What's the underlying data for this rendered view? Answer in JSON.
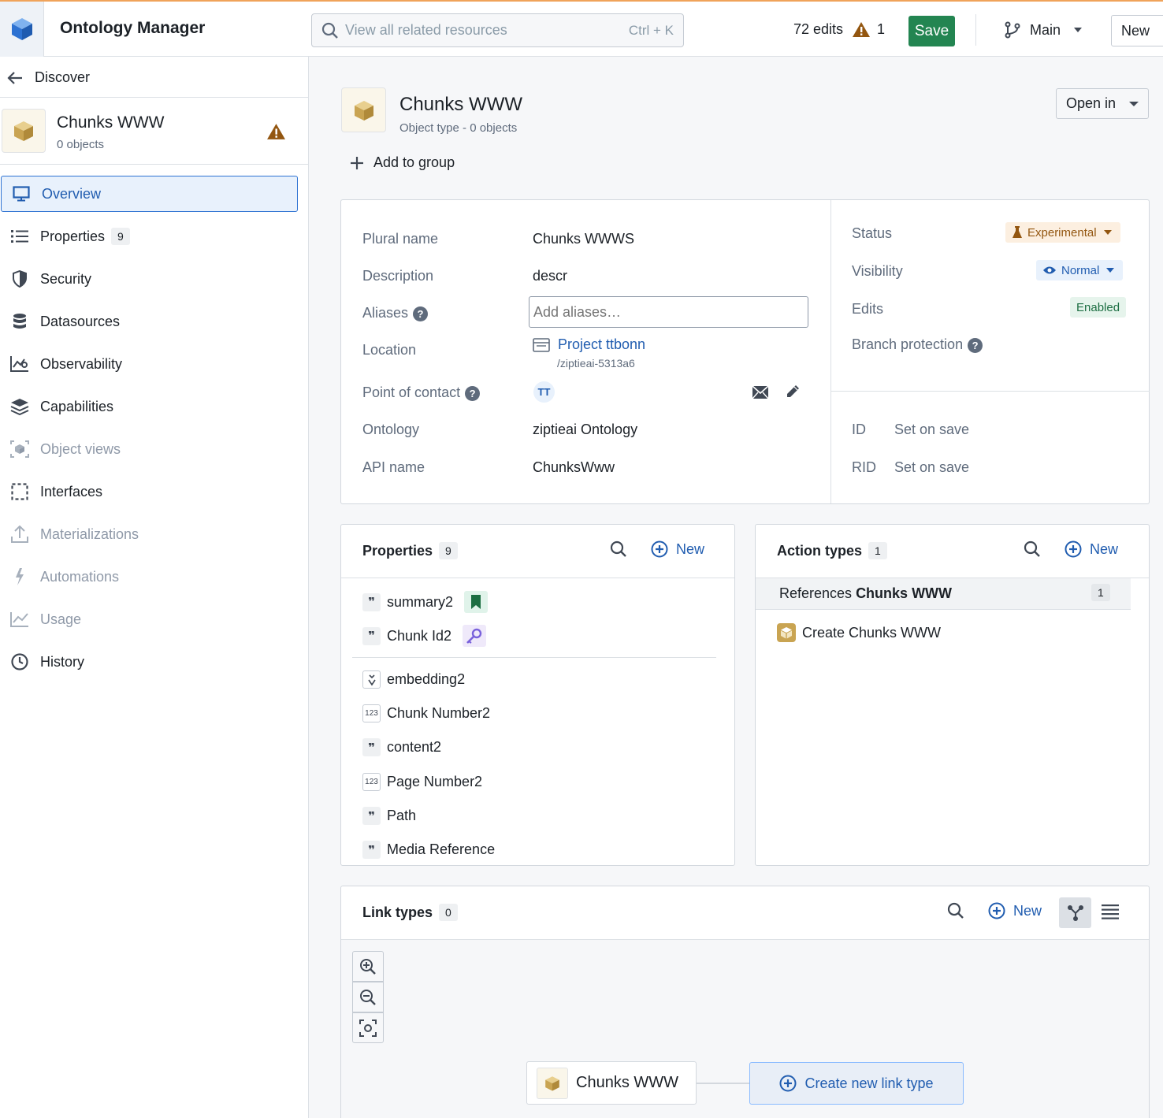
{
  "app": {
    "title": "Ontology Manager"
  },
  "search": {
    "placeholder": "View all related resources",
    "shortcut": "Ctrl + K"
  },
  "topbar": {
    "edits": "72 edits",
    "warnings": "1",
    "save_label": "Save",
    "branch": "Main",
    "new_label": "New"
  },
  "sidebar": {
    "back_label": "Discover",
    "object": {
      "name": "Chunks WWW",
      "count": "0 objects"
    },
    "items": [
      {
        "label": "Overview",
        "icon": "desktop-icon",
        "state": "active"
      },
      {
        "label": "Properties",
        "icon": "list-icon",
        "badge": "9"
      },
      {
        "label": "Security",
        "icon": "shield-icon"
      },
      {
        "label": "Datasources",
        "icon": "database-icon"
      },
      {
        "label": "Observability",
        "icon": "chart-icon"
      },
      {
        "label": "Capabilities",
        "icon": "layers-icon"
      },
      {
        "label": "Object views",
        "icon": "object-view-icon",
        "state": "disabled"
      },
      {
        "label": "Interfaces",
        "icon": "dashed-square-icon"
      },
      {
        "label": "Materializations",
        "icon": "upload-icon",
        "state": "disabled"
      },
      {
        "label": "Automations",
        "icon": "lightning-icon",
        "state": "disabled"
      },
      {
        "label": "Usage",
        "icon": "timeline-icon",
        "state": "disabled"
      },
      {
        "label": "History",
        "icon": "clock-icon"
      }
    ]
  },
  "header": {
    "title": "Chunks WWW",
    "subtitle": "Object type - 0 objects",
    "open_in": "Open in",
    "add_group": "Add to group"
  },
  "details": {
    "plural_label": "Plural name",
    "plural_value": "Chunks WWWS",
    "desc_label": "Description",
    "desc_value": "descr",
    "aliases_label": "Aliases",
    "aliases_placeholder": "Add aliases…",
    "location_label": "Location",
    "location_value": "Project ttbonn",
    "location_path": "/ziptieai-5313a6",
    "contact_label": "Point of contact",
    "contact_initials": "TT",
    "ontology_label": "Ontology",
    "ontology_value": "ziptieai Ontology",
    "api_label": "API name",
    "api_value": "ChunksWww"
  },
  "meta": {
    "status_label": "Status",
    "status_value": "Experimental",
    "visibility_label": "Visibility",
    "visibility_value": "Normal",
    "edits_label": "Edits",
    "edits_value": "Enabled",
    "branch_label": "Branch protection",
    "id_label": "ID",
    "id_value": "Set on save",
    "rid_label": "RID",
    "rid_value": "Set on save"
  },
  "properties_panel": {
    "title": "Properties",
    "count": "9",
    "new_label": "New",
    "items": [
      {
        "name": "summary2",
        "type": "string"
      },
      {
        "name": "Chunk Id2",
        "type": "string"
      },
      {
        "name": "embedding2",
        "type": "vector"
      },
      {
        "name": "Chunk Number2",
        "type": "integer"
      },
      {
        "name": "content2",
        "type": "string"
      },
      {
        "name": "Page Number2",
        "type": "integer"
      },
      {
        "name": "Path",
        "type": "string"
      },
      {
        "name": "Media Reference",
        "type": "string"
      }
    ]
  },
  "actions_panel": {
    "title": "Action types",
    "count": "1",
    "new_label": "New",
    "group_prefix": "References ",
    "group_bold": "Chunks WWW",
    "group_count": "1",
    "items": [
      {
        "name": "Create Chunks WWW"
      }
    ]
  },
  "links_panel": {
    "title": "Link types",
    "count": "0",
    "new_label": "New",
    "node_label": "Chunks WWW",
    "create_label": "Create new link type"
  },
  "colors": {
    "accent": "#2d72d2",
    "save": "#238551",
    "warning": "#c87619",
    "object": "#d1b06b"
  }
}
